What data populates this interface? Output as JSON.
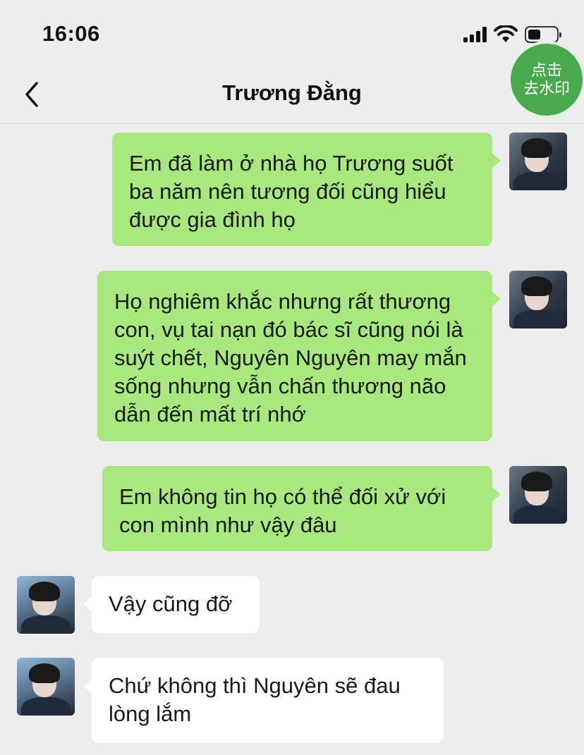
{
  "status": {
    "time": "16:06"
  },
  "header": {
    "title": "Trương Đằng",
    "watermark_button": [
      "点击",
      "去水印"
    ]
  },
  "messages": [
    {
      "side": "right",
      "text": "Em đã làm ở nhà họ Trương suốt ba năm nên tương đối cũng hiểu được gia đình họ"
    },
    {
      "side": "right",
      "text": "Họ nghiêm khắc nhưng rất thương con, vụ tai nạn đó bác sĩ cũng nói là suýt chết, Nguyên Nguyên may mắn sống nhưng vẫn chấn thương não dẫn đến mất trí nhớ"
    },
    {
      "side": "right",
      "text": "Em không tin họ có thể đối xử với con mình như vậy đâu"
    },
    {
      "side": "left",
      "text": "Vậy cũng đỡ"
    },
    {
      "side": "left",
      "text": "Chứ không thì Nguyên sẽ đau lòng lắm"
    }
  ]
}
